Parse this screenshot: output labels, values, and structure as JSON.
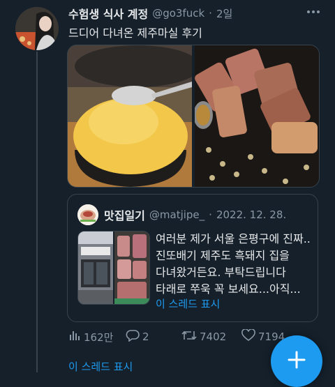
{
  "tweet": {
    "display_name": "수험생 식사 계정",
    "handle": "@go3fuck",
    "separator": "·",
    "time": "2일",
    "text": "드디어 다녀온 제주마실 후기",
    "more_icon": "more-dots-icon"
  },
  "quote": {
    "display_name": "맛집일기",
    "handle": "@matjipe_",
    "separator": "·",
    "date": "2022. 12. 28.",
    "text": "여러분 제가 서울 은평구에 진짜..진또배기 제주도 흑돼지 집을 다녀왔거든요. 부탁드립니다 타래로 쭈욱 꼭 보세요...아직...",
    "show_thread": "이 스레드 표시"
  },
  "actions": {
    "views": "162만",
    "replies": "2",
    "retweets": "7402",
    "likes": "7194"
  },
  "show_thread": "이 스레드 표시",
  "colors": {
    "background": "#15202b",
    "accent": "#1d9bf0",
    "muted": "#8b98a5",
    "border": "#38444d"
  }
}
